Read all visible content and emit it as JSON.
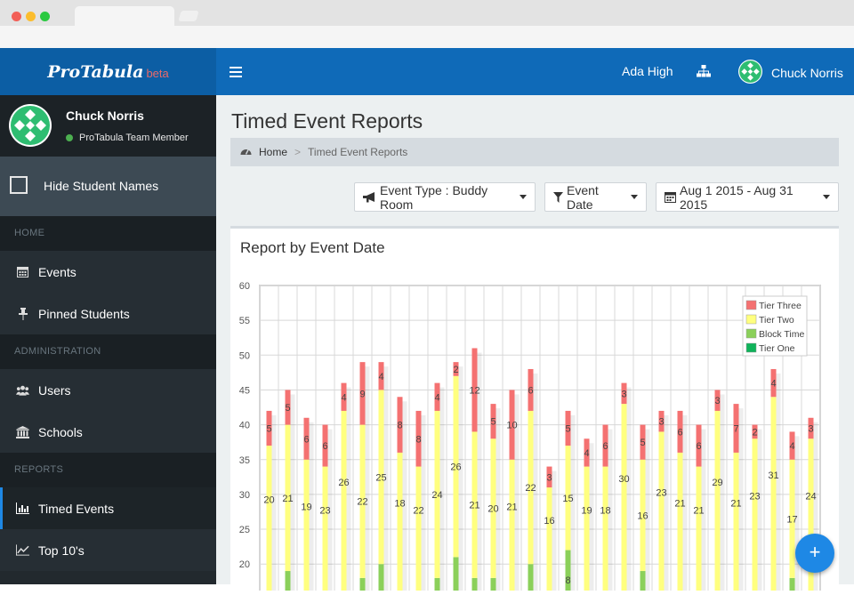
{
  "app": {
    "brand": "ProTabula",
    "beta": "beta",
    "menu_icon": "hamburger-icon"
  },
  "navbar": {
    "school": "Ada High",
    "sitemap_icon": "sitemap-icon",
    "user_name": "Chuck Norris"
  },
  "sidebar": {
    "profile": {
      "name": "Chuck Norris",
      "role": "ProTabula Team Member",
      "status_color": "#4caf50"
    },
    "hide_names_label": "Hide Student Names",
    "sections": {
      "home": "HOME",
      "administration": "ADMINISTRATION",
      "reports": "REPORTS"
    },
    "items": {
      "events": {
        "label": "Events",
        "icon": "calendar-icon"
      },
      "pinned": {
        "label": "Pinned Students",
        "icon": "pin-icon"
      },
      "users": {
        "label": "Users",
        "icon": "users-icon"
      },
      "schools": {
        "label": "Schools",
        "icon": "institution-icon"
      },
      "timed_events": {
        "label": "Timed Events",
        "icon": "bar-chart-icon",
        "active": true
      },
      "top10": {
        "label": "Top 10's",
        "icon": "line-chart-icon"
      }
    }
  },
  "page": {
    "title": "Timed Event Reports",
    "breadcrumb": {
      "home": "Home",
      "separator": ">",
      "current": "Timed Event Reports"
    },
    "filters": {
      "event_type": "Event Type : Buddy Room",
      "event_date": "Event Date",
      "date_range": "Aug 1 2015 - Aug 31 2015"
    },
    "panel_title": "Report by Event Date",
    "fab_label": "+"
  },
  "colors": {
    "navbar": "#0f6ab8",
    "accent": "#1e88e5",
    "tier_three": "#f47171",
    "tier_two": "#ffff7f",
    "block_time": "#8bd05a",
    "tier_one": "#0fb35a"
  },
  "chart_data": {
    "type": "bar",
    "stacked": true,
    "title": "",
    "ylim": [
      0,
      60
    ],
    "y_ticks": [
      20,
      25,
      30,
      35,
      40,
      45,
      50,
      55,
      60
    ],
    "legend_position": "top-right",
    "grid": true,
    "series": [
      {
        "name": "Tier Three",
        "color": "#f47171"
      },
      {
        "name": "Tier Two",
        "color": "#ffff7f"
      },
      {
        "name": "Block Time",
        "color": "#8bd05a"
      },
      {
        "name": "Tier One",
        "color": "#0fb35a"
      }
    ],
    "bars": [
      {
        "green": 0,
        "yellow": 20,
        "red": 5,
        "total": 42
      },
      {
        "green": 19,
        "yellow": 21,
        "red": 5,
        "total": 45
      },
      {
        "green": 0,
        "yellow": 19,
        "red": 6,
        "total": 41
      },
      {
        "green": 0,
        "yellow": 23,
        "red": 6,
        "total": 40
      },
      {
        "green": 0,
        "yellow": 26,
        "red": 4,
        "total": 46
      },
      {
        "green": 18,
        "yellow": 22,
        "red": 9,
        "total": 49
      },
      {
        "green": 20,
        "yellow": 25,
        "red": 4,
        "total": 49
      },
      {
        "green": 0,
        "yellow": 18,
        "red": 8,
        "total": 44
      },
      {
        "green": 0,
        "yellow": 22,
        "red": 8,
        "total": 42
      },
      {
        "green": 18,
        "yellow": 24,
        "red": 4,
        "total": 46
      },
      {
        "green": 21,
        "yellow": 26,
        "red": 2,
        "total": 49
      },
      {
        "green": 18,
        "yellow": 21,
        "red": 12,
        "total": 51
      },
      {
        "green": 18,
        "yellow": 20,
        "red": 5,
        "total": 43
      },
      {
        "green": 0,
        "yellow": 21,
        "red": 10,
        "total": 45
      },
      {
        "green": 20,
        "yellow": 22,
        "red": 6,
        "total": 48
      },
      {
        "green": 0,
        "yellow": 16,
        "red": 3,
        "total": 34
      },
      {
        "green": 22,
        "yellow": 15,
        "red": 5,
        "total": 42
      },
      {
        "green": 0,
        "yellow": 19,
        "red": 4,
        "total": 38
      },
      {
        "green": 0,
        "yellow": 18,
        "red": 6,
        "total": 40
      },
      {
        "green": 0,
        "yellow": 30,
        "red": 3,
        "total": 46
      },
      {
        "green": 19,
        "yellow": 16,
        "red": 5,
        "total": 40
      },
      {
        "green": 0,
        "yellow": 23,
        "red": 3,
        "total": 42
      },
      {
        "green": 0,
        "yellow": 21,
        "red": 6,
        "total": 42
      },
      {
        "green": 0,
        "yellow": 21,
        "red": 6,
        "total": 40
      },
      {
        "green": 0,
        "yellow": 29,
        "red": 3,
        "total": 45
      },
      {
        "green": 0,
        "yellow": 21,
        "red": 7,
        "total": 43
      },
      {
        "green": 0,
        "yellow": 23,
        "red": 2,
        "total": 40
      },
      {
        "green": 0,
        "yellow": 31,
        "red": 4,
        "total": 48
      },
      {
        "green": 18,
        "yellow": 17,
        "red": 4,
        "total": 39
      },
      {
        "green": 0,
        "yellow": 24,
        "red": 3,
        "total": 41
      }
    ],
    "green_labels": {
      "16": "8"
    }
  }
}
